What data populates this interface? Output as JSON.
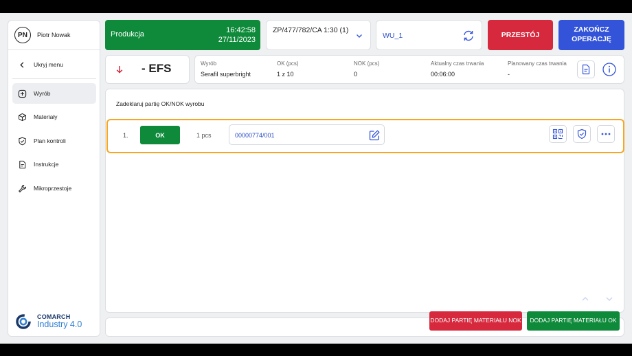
{
  "user": {
    "initials": "PN",
    "name": "Piotr Nowak"
  },
  "sidebar": {
    "hide_menu": "Ukryj menu",
    "items": [
      {
        "label": "Wyrób",
        "icon": "plus-square-icon",
        "active": true
      },
      {
        "label": "Materiały",
        "icon": "box-icon"
      },
      {
        "label": "Plan kontroli",
        "icon": "shield-check-icon"
      },
      {
        "label": "Instrukcje",
        "icon": "document-icon"
      },
      {
        "label": "Mikroprzestoje",
        "icon": "wrench-icon"
      }
    ]
  },
  "logo": {
    "line1": "COMARCH",
    "line2": "Industry 4.0"
  },
  "header": {
    "status": "Produkcja",
    "time": "16:42:58",
    "date": "27/11/2023",
    "order": "ZP/477/782/CA 1:30 (1)",
    "workstation": "WU_1",
    "stop_button": "PRZESTÓJ",
    "end_button": "ZAKOŃCZ OPERACJĘ"
  },
  "operation": {
    "code": "- EFS"
  },
  "info": {
    "product_label": "Wyrób",
    "product_value": "Serafil superbright",
    "ok_label": "OK (pcs)",
    "ok_value": "1 z 10",
    "nok_label": "NOK (pcs)",
    "nok_value": "0",
    "current_time_label": "Aktualny czas trwania",
    "current_time_value": "00:06:00",
    "planned_time_label": "Planowany czas trwania",
    "planned_time_value": "-"
  },
  "main": {
    "title": "Zadeklaruj partię OK/NOK wyrobu",
    "rows": [
      {
        "index": "1.",
        "status": "OK",
        "qty": "1 pcs",
        "batch": "00000774/001"
      }
    ]
  },
  "footer": {
    "add_nok": "DODAJ PARTIĘ MATERIAŁU NOK",
    "add_ok": "DODAJ PARTIĘ MATERIAŁU OK"
  },
  "colors": {
    "green": "#0e8a3a",
    "red": "#d6293e",
    "blue": "#3354d9",
    "highlight": "#f5a623",
    "link": "#2b4fc7"
  }
}
